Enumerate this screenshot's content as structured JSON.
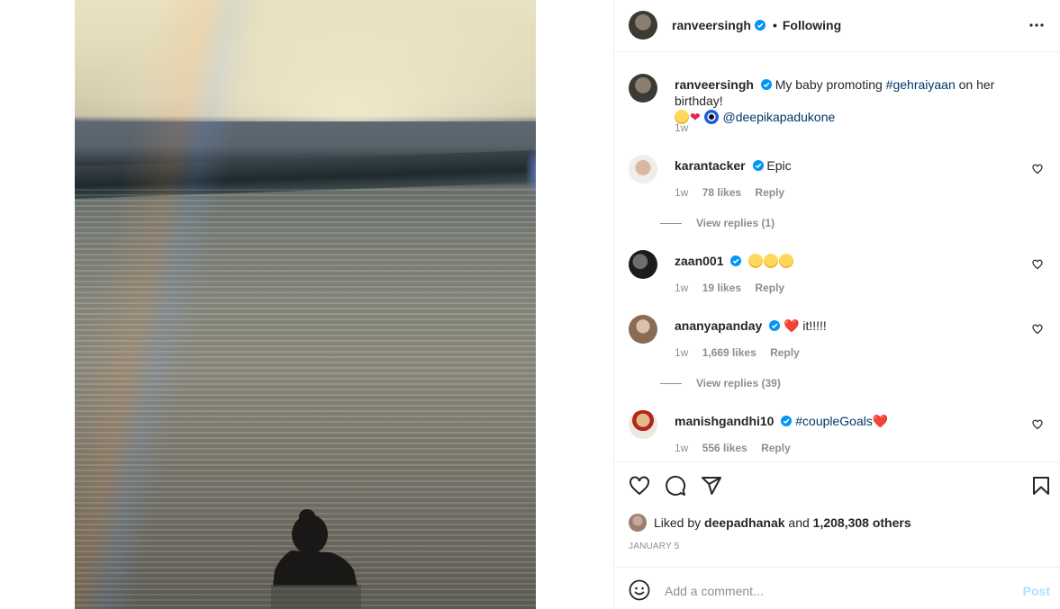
{
  "post": {
    "author": "ranveersingh",
    "follow_separator": "•",
    "follow_status": "Following"
  },
  "caption": {
    "username": "ranveersingh",
    "text_before": "My baby promoting ",
    "hashtag": "#gehraiyaan",
    "text_after": " on her birthday!",
    "mention": "@deepikapadukone",
    "time": "1w"
  },
  "comments": [
    {
      "username": "karantacker",
      "verified": true,
      "text": "Epic",
      "time": "1w",
      "likes": "78 likes",
      "reply": "Reply",
      "view_replies": "View replies (1)"
    },
    {
      "username": "zaan001",
      "verified": true,
      "text": "",
      "time": "1w",
      "likes": "19 likes",
      "reply": "Reply"
    },
    {
      "username": "ananyapanday",
      "verified": true,
      "text": "it!!!!!",
      "time": "1w",
      "likes": "1,669 likes",
      "reply": "Reply",
      "view_replies": "View replies (39)"
    },
    {
      "username": "manishgandhi10",
      "verified": true,
      "text": "#coupleGoals",
      "time": "1w",
      "likes": "556 likes",
      "reply": "Reply"
    }
  ],
  "likes": {
    "prefix": "Liked by ",
    "user": "deepadhanak",
    "middle": " and ",
    "count": "1,208,308 others"
  },
  "date": "JANUARY 5",
  "add_comment": {
    "placeholder": "Add a comment...",
    "post_label": "Post"
  },
  "colors": {
    "verified": "#0095f6",
    "link": "#00376b",
    "muted": "#8e8e8e",
    "post_disabled": "#b2dffc"
  },
  "icons": [
    "more-icon",
    "heart-icon",
    "comment-icon",
    "share-icon",
    "bookmark-icon",
    "emoji-icon",
    "verified-icon"
  ]
}
